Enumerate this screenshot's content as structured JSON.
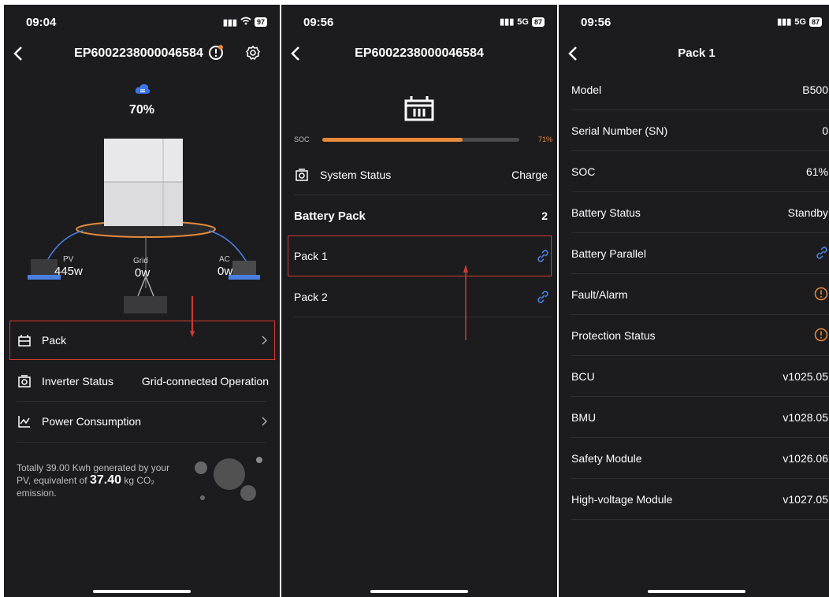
{
  "screen1": {
    "time": "09:04",
    "battery": "97",
    "title": "EP6002238000046584",
    "cloud_percent": "70%",
    "pv": {
      "label": "PV",
      "value": "445w"
    },
    "grid": {
      "label": "Grid",
      "value": "0w"
    },
    "ac": {
      "label": "AC",
      "value": "0w"
    },
    "rows": {
      "pack": "Pack",
      "inverter_label": "Inverter Status",
      "inverter_value": "Grid-connected Operation",
      "power_consumption": "Power Consumption"
    },
    "footer": {
      "line1": "Totally 39.00 Kwh generated by your",
      "line2_pre": "PV, equivalent of ",
      "line2_num": "37.40",
      "line2_post": " kg CO₂",
      "line3": "emission."
    }
  },
  "screen2": {
    "time": "09:56",
    "network": "5G",
    "battery": "87",
    "title": "EP6002238000046584",
    "soc_label": "SOC",
    "soc_value": "71%",
    "soc_level": 0.71,
    "system_status_label": "System Status",
    "system_status_value": "Charge",
    "battery_pack_label": "Battery Pack",
    "battery_pack_count": "2",
    "packs": [
      "Pack 1",
      "Pack 2"
    ]
  },
  "screen3": {
    "time": "09:56",
    "network": "5G",
    "battery": "87",
    "title": "Pack 1",
    "rows": [
      {
        "label": "Model",
        "value": "B500"
      },
      {
        "label": "Serial Number (SN)",
        "value": "0"
      },
      {
        "label": "SOC",
        "value": "61%"
      },
      {
        "label": "Battery Status",
        "value": "Standby"
      },
      {
        "label": "Battery Parallel",
        "value": ""
      },
      {
        "label": "Fault/Alarm",
        "value": ""
      },
      {
        "label": "Protection Status",
        "value": ""
      },
      {
        "label": "BCU",
        "value": "v1025.05"
      },
      {
        "label": "BMU",
        "value": "v1028.05"
      },
      {
        "label": "Safety Module",
        "value": "v1026.06"
      },
      {
        "label": "High-voltage Module",
        "value": "v1027.05"
      }
    ]
  },
  "colors": {
    "accent_orange": "#e8893a",
    "link_blue": "#4a7fe0",
    "highlight_red": "#d23a32",
    "background": "#1c1c1e"
  }
}
